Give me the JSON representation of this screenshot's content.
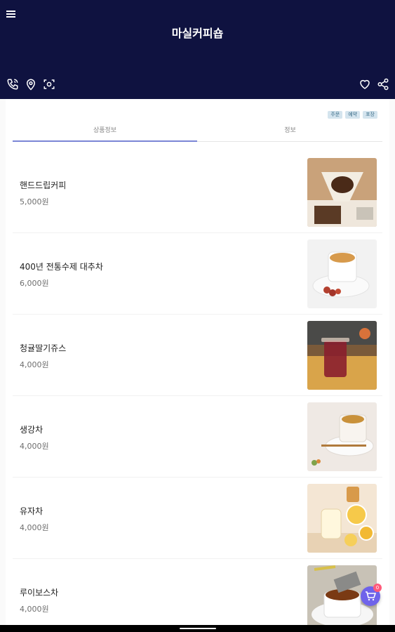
{
  "header": {
    "title": "마실커피숍",
    "icons": [
      "menu-icon",
      "phone-icon",
      "location-icon",
      "scan-icon",
      "heart-icon",
      "share-icon"
    ]
  },
  "badges": [
    "주문",
    "예약",
    "포장"
  ],
  "tabs": [
    {
      "label": "상품정보",
      "active": true
    },
    {
      "label": "정보",
      "active": false
    }
  ],
  "products": [
    {
      "name": "핸드드립커피",
      "price": "5,000원"
    },
    {
      "name": "400년 전통수제 대추차",
      "price": "6,000원"
    },
    {
      "name": "청귤딸기쥬스",
      "price": "4,000원"
    },
    {
      "name": "생강차",
      "price": "4,000원"
    },
    {
      "name": "유자차",
      "price": "4,000원"
    },
    {
      "name": "루이보스차",
      "price": "4,000원"
    }
  ],
  "cart": {
    "count": "0"
  },
  "colors": {
    "header": "#0f1240",
    "accent": "#7b86d6",
    "cart": "#6f63ea"
  }
}
